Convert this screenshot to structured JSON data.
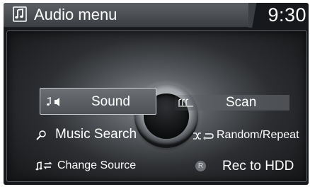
{
  "header": {
    "title": "Audio menu",
    "clock": "9:30",
    "title_icon": "music-note-icon"
  },
  "menu": {
    "sound": {
      "label": "Sound",
      "icon": "sound-settings-icon",
      "selected": true
    },
    "scan": {
      "label": "Scan",
      "icon": "scan-icon"
    },
    "music_search": {
      "label": "Music Search",
      "icon": "search-icon"
    },
    "random_repeat": {
      "label": "Random/Repeat",
      "icon": "shuffle-repeat-icon"
    },
    "change_source": {
      "label": "Change Source",
      "icon": "change-source-icon"
    },
    "rec_to_hdd": {
      "label": "Rec to HDD",
      "badge": "R"
    }
  },
  "colors": {
    "screen_bg": "#16181b",
    "header_bg": "#4a4d51",
    "text": "#ffffff",
    "highlight_border": "#c9ccd0"
  }
}
